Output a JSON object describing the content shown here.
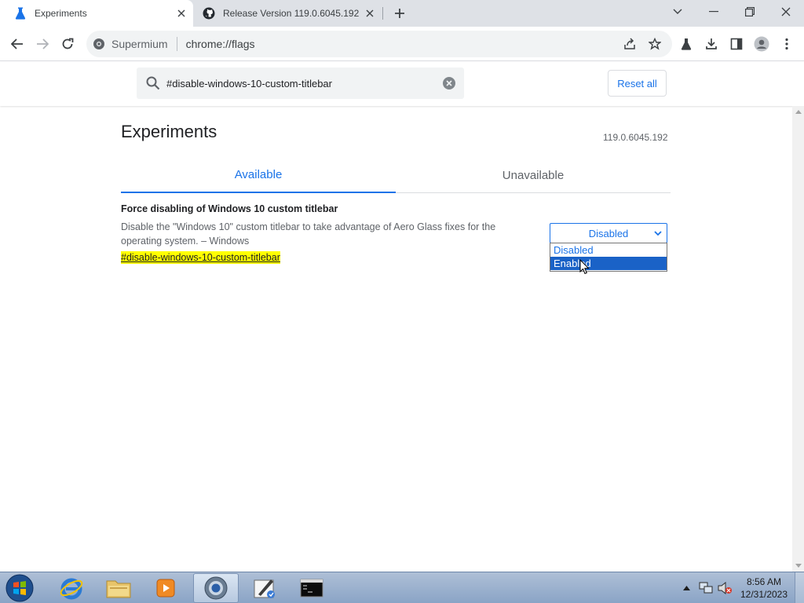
{
  "browser": {
    "tabs": [
      {
        "title": "Experiments",
        "active": true,
        "icon": "flask-icon"
      },
      {
        "title": "Release Version 119.0.6045.192",
        "active": false,
        "icon": "github-icon"
      }
    ],
    "omnibox": {
      "chip": "Supermium",
      "url": "chrome://flags"
    }
  },
  "flags": {
    "search_value": "#disable-windows-10-custom-titlebar",
    "reset_label": "Reset all",
    "page_title": "Experiments",
    "version": "119.0.6045.192",
    "tabs": [
      {
        "label": "Available",
        "selected": true
      },
      {
        "label": "Unavailable",
        "selected": false
      }
    ],
    "experiment": {
      "title": "Force disabling of Windows 10 custom titlebar",
      "description": "Disable the \"Windows 10\" custom titlebar to take advantage of Aero Glass fixes for the operating system. – Windows",
      "link": "#disable-windows-10-custom-titlebar",
      "selected": "Disabled",
      "options": [
        "Disabled",
        "Enabled"
      ],
      "highlighted_option": "Enabled"
    }
  },
  "taskbar": {
    "items": [
      "internet-explorer-icon",
      "file-explorer-icon",
      "media-player-icon",
      "supermium-icon",
      "paint-tool-icon",
      "command-prompt-icon"
    ],
    "active_item": "supermium-icon",
    "time": "8:56 AM",
    "date": "12/31/2023"
  },
  "colors": {
    "accent": "#1a73e8",
    "highlight": "#ffff00",
    "dropdown_highlight": "#1a62c7"
  }
}
